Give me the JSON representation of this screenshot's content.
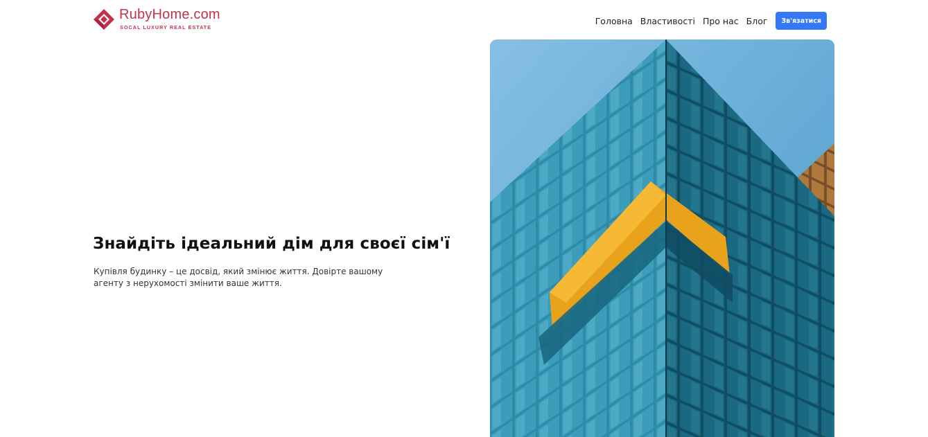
{
  "brand": {
    "name": "RubyHome.com",
    "tagline": "SOCAL LUXURY REAL ESTATE",
    "icon": "diamond-logo-icon",
    "color": "#c4314b"
  },
  "nav": {
    "links": [
      {
        "label": "Головна"
      },
      {
        "label": "Властивості"
      },
      {
        "label": "Про нас"
      },
      {
        "label": "Блог"
      }
    ],
    "cta_label": "Зв'язатися",
    "cta_color": "#3478f6"
  },
  "hero": {
    "title": "Знайдіть ідеальний дім для своєї сім'ї",
    "subtitle": "Купівля будинку – це досвід, який змінює життя. Довірте вашому агенту з нерухомості змінити ваше життя."
  }
}
